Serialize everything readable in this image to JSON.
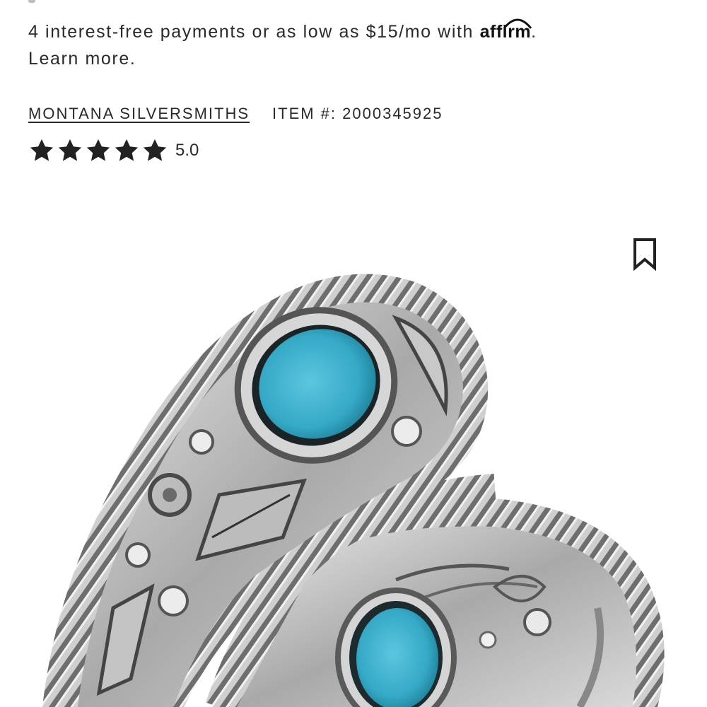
{
  "payments": {
    "prefix": "4 interest-free payments or as low as $15/mo with",
    "affirm_logo": "affirm",
    "suffix": ".",
    "learn_more": "Learn more."
  },
  "product": {
    "brand": "MONTANA SILVERSMITHS",
    "item_number": "ITEM #: 2000345925",
    "rating": {
      "stars_filled": 5,
      "stars_total": 5,
      "value_label": "5.0"
    }
  },
  "icons": {
    "save": "bookmark-icon",
    "star": "star-icon"
  },
  "colors": {
    "text": "#2a2a2a",
    "turquoise": "#3fb2cf",
    "silver": "#c9c9c9"
  }
}
